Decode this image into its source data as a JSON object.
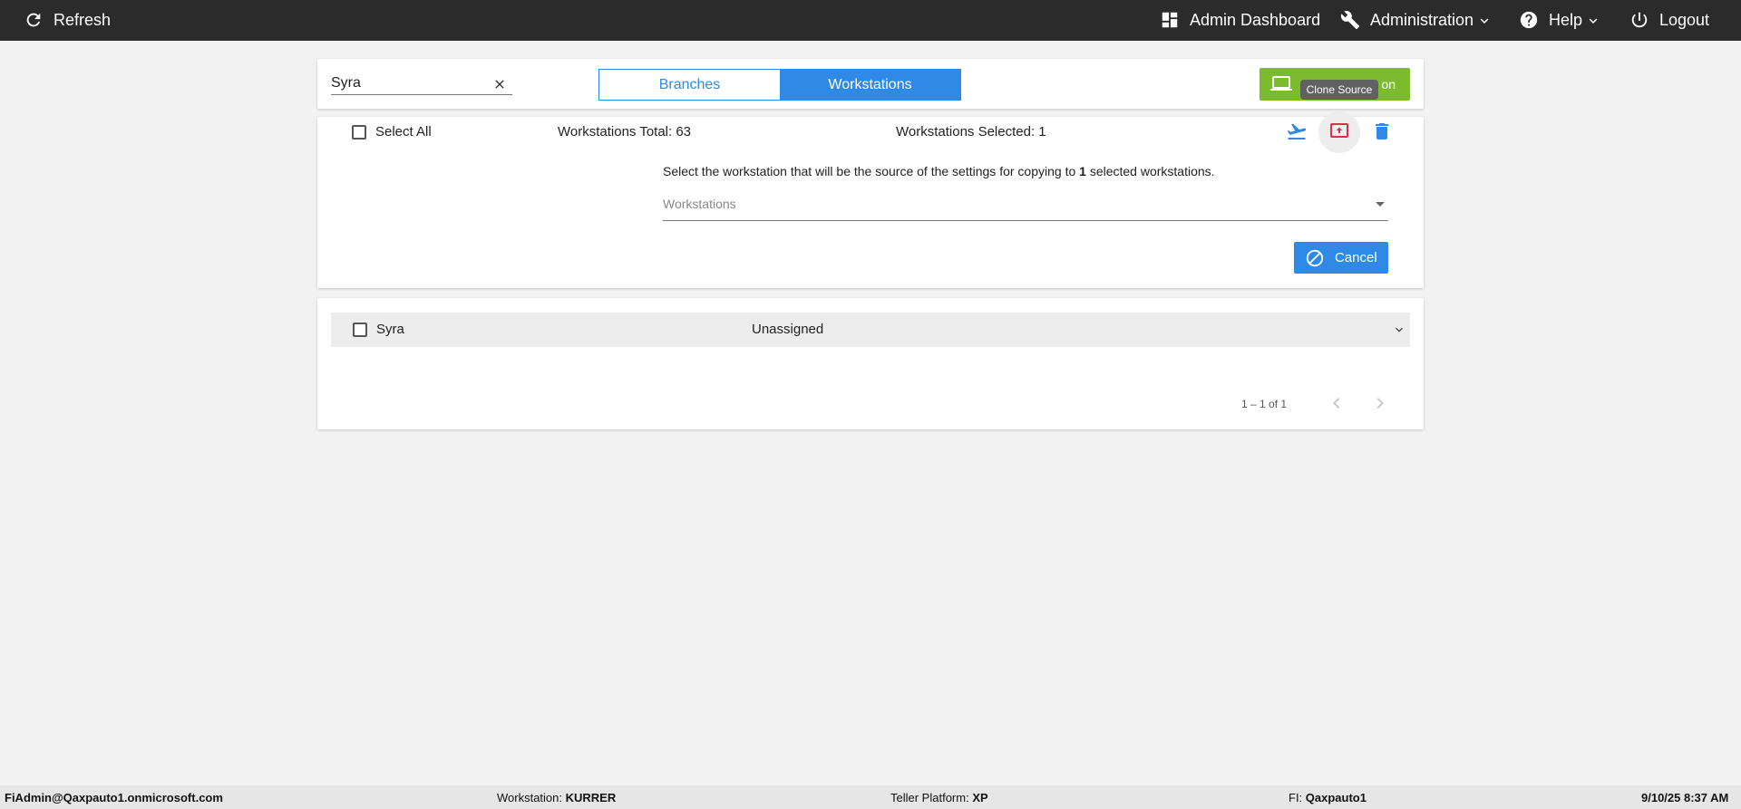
{
  "topnav": {
    "refresh_label": "Refresh",
    "admin_dashboard_label": "Admin Dashboard",
    "administration_label": "Administration",
    "help_label": "Help",
    "logout_label": "Logout"
  },
  "toolbar": {
    "search_value": "Syra",
    "tabs": [
      "Branches",
      "Workstations"
    ],
    "active_tab": "Workstations",
    "green_button_label": "on",
    "tooltip": "Clone Source"
  },
  "selection": {
    "select_all_label": "Select All",
    "total_text": "Workstations Total: 63",
    "selected_text": "Workstations Selected: 1",
    "instruction_prefix": "Select the workstation that will be the source of the settings for copying to ",
    "instruction_count": "1",
    "instruction_suffix": " selected workstations.",
    "dropdown_placeholder": "Workstations",
    "cancel_label": "Cancel"
  },
  "list": {
    "rows": [
      {
        "name": "Syra",
        "branch": "Unassigned"
      }
    ],
    "pager_range": "1 – 1 of 1"
  },
  "footer": {
    "user": "FiAdmin@Qaxpauto1.onmicrosoft.com",
    "workstation_label": "Workstation: ",
    "workstation_value": "KURRER",
    "platform_label": "Teller Platform: ",
    "platform_value": "XP",
    "fi_label": "FI: ",
    "fi_value": "Qaxpauto1",
    "datetime": "9/10/25 8:37 AM"
  },
  "colors": {
    "accent": "#2e8ae6",
    "green": "#7dbb2e",
    "danger": "#d9304a",
    "topbar": "#2b2b2b"
  },
  "icons": [
    "refresh-icon",
    "dashboard-icon",
    "wrench-icon",
    "help-icon",
    "power-icon",
    "chevron-down-icon",
    "close-icon",
    "laptop-icon",
    "flight-takeoff-icon",
    "clone-source-icon",
    "trash-icon",
    "block-icon",
    "chevron-left-icon",
    "chevron-right-icon"
  ]
}
